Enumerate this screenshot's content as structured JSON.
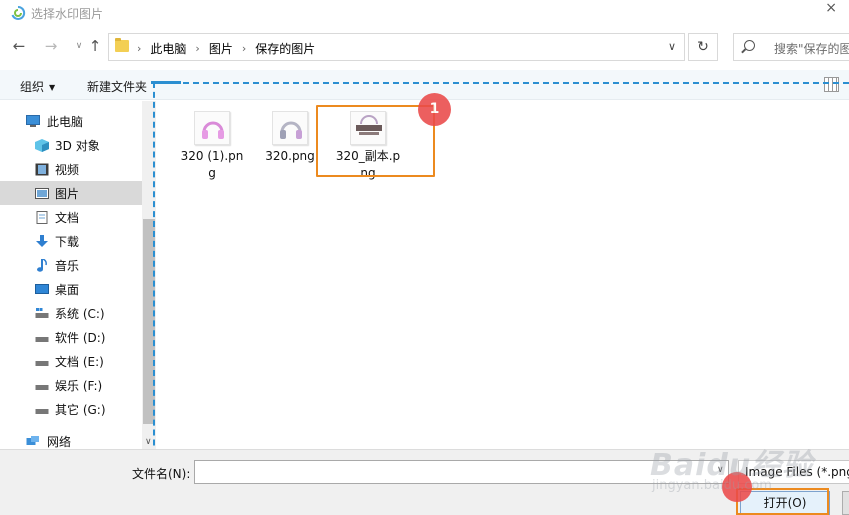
{
  "window": {
    "title": "选择水印图片"
  },
  "address": {
    "crumbs": [
      "此电脑",
      "图片",
      "保存的图片"
    ],
    "search_placeholder": "搜索\"保存的图片\""
  },
  "toolbar": {
    "organize": "组织",
    "new_folder": "新建文件夹"
  },
  "nav": {
    "items": [
      {
        "label": "此电脑",
        "icon": "computer-icon"
      },
      {
        "label": "3D 对象",
        "icon": "3d-objects-icon"
      },
      {
        "label": "视频",
        "icon": "video-icon"
      },
      {
        "label": "图片",
        "icon": "pictures-icon",
        "selected": true
      },
      {
        "label": "文档",
        "icon": "document-icon"
      },
      {
        "label": "下载",
        "icon": "download-icon"
      },
      {
        "label": "音乐",
        "icon": "music-icon"
      },
      {
        "label": "桌面",
        "icon": "desktop-icon"
      },
      {
        "label": "系统 (C:)",
        "icon": "drive-icon"
      },
      {
        "label": "软件 (D:)",
        "icon": "drive-icon"
      },
      {
        "label": "文档 (E:)",
        "icon": "drive-icon"
      },
      {
        "label": "娱乐 (F:)",
        "icon": "drive-icon"
      },
      {
        "label": "其它 (G:)",
        "icon": "drive-icon"
      },
      {
        "label": "网络",
        "icon": "network-icon"
      }
    ]
  },
  "files": [
    {
      "name": "320 (1).png"
    },
    {
      "name": "320.png"
    },
    {
      "name": "320_副本.png"
    }
  ],
  "annotations": {
    "step1": "1"
  },
  "bottom": {
    "filename_label": "文件名(N):",
    "filename_value": "",
    "filetype": "Image Files (*.png",
    "open": "打开(O)"
  },
  "watermark": {
    "brand": "Baidu经验",
    "sub": "jingyan.baidu.com"
  },
  "colors": {
    "accent_blue": "#2b8fd1",
    "highlight_orange": "#ec8a1f",
    "badge_red": "#ea4a4a",
    "selected_bg": "#d9d9d9"
  }
}
